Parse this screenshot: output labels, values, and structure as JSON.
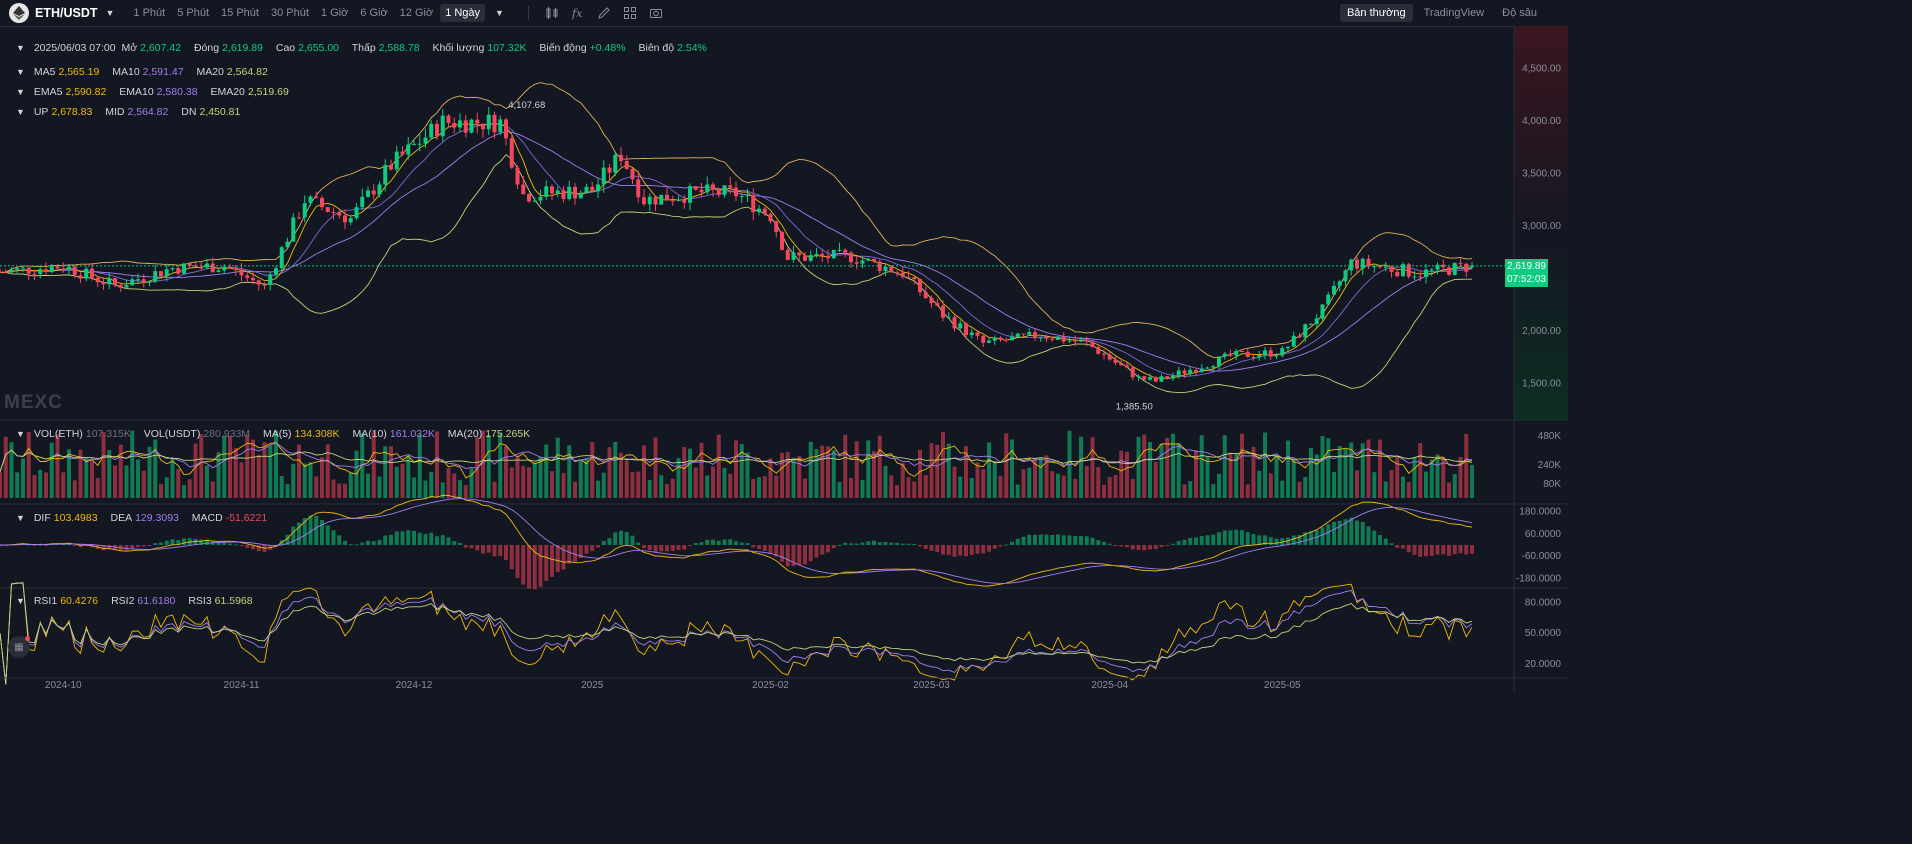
{
  "header": {
    "symbol": "ETH/USDT",
    "timeframes": [
      "1 Phút",
      "5 Phút",
      "15 Phút",
      "30 Phút",
      "1 Giờ",
      "6 Giờ",
      "12 Giờ",
      "1 Ngày"
    ],
    "active_timeframe": "1 Ngày",
    "tools": [
      "candle-type-icon",
      "indicator-icon",
      "draw-icon",
      "layout-icon",
      "camera-icon"
    ],
    "view_tabs": [
      "Bản thường",
      "TradingView",
      "Độ sâu"
    ],
    "active_view": "Bản thường"
  },
  "ohlc": {
    "date": "2025/06/03 07:00",
    "open_label": "Mở",
    "open": "2,607.42",
    "close_label": "Đóng",
    "close": "2,619.89",
    "high_label": "Cao",
    "high": "2,655.00",
    "low_label": "Thấp",
    "low": "2,588.78",
    "volume_label": "Khối lượng",
    "volume": "107.32K",
    "change_label": "Biến động",
    "change": "+0.48%",
    "amplitude_label": "Biên độ",
    "amplitude": "2.54%"
  },
  "ma": {
    "ma5_label": "MA5",
    "ma5": "2,565.19",
    "ma10_label": "MA10",
    "ma10": "2,591.47",
    "ma20_label": "MA20",
    "ma20": "2,564.82"
  },
  "ema": {
    "ema5_label": "EMA5",
    "ema5": "2,590.82",
    "ema10_label": "EMA10",
    "ema10": "2,580.38",
    "ema20_label": "EMA20",
    "ema20": "2,519.69"
  },
  "boll": {
    "up_label": "UP",
    "up": "2,678.83",
    "mid_label": "MID",
    "mid": "2,564.82",
    "dn_label": "DN",
    "dn": "2,450.81"
  },
  "vol": {
    "eth_label": "VOL(ETH)",
    "eth": "107.315K",
    "usdt_label": "VOL(USDT)",
    "usdt": "280.933M",
    "ma5_label": "MA(5)",
    "ma5": "134.308K",
    "ma10_label": "MA(10)",
    "ma10": "161.032K",
    "ma20_label": "MA(20)",
    "ma20": "175.265K"
  },
  "macd": {
    "dif_label": "DIF",
    "dif": "103.4983",
    "dea_label": "DEA",
    "dea": "129.3093",
    "macd_label": "MACD",
    "macd": "-51.6221"
  },
  "rsi": {
    "rsi1_label": "RSI1",
    "rsi1": "60.4276",
    "rsi2_label": "RSI2",
    "rsi2": "61.6180",
    "rsi3_label": "RSI3",
    "rsi3": "61.5968"
  },
  "watermark": "MEXC",
  "price_tag": {
    "price": "2,619.89",
    "countdown": "07:52:03"
  },
  "max_label": "4,107.68",
  "min_label": "1,385.50",
  "colors": {
    "up": "#0ecb81",
    "down": "#f6465d",
    "ma5": "#f0b90b",
    "ma10": "#a27ef0",
    "ma20": "#c3d47a",
    "boll": "#e0b25a"
  },
  "chart_data": {
    "type": "candlestick",
    "series_summary": "ETH/USDT daily candles, Sep 2024 – Jun 2025",
    "price_axis": {
      "ticks": [
        "4,500.00",
        "4,000.00",
        "3,500.00",
        "3,000.00",
        "2,000.00",
        "1,500.00"
      ],
      "ylim": [
        1150,
        4850
      ]
    },
    "x_ticks": [
      "2024-10",
      "2024-11",
      "2024-12",
      "2025",
      "2025-02",
      "2025-03",
      "2025-04",
      "2025-05"
    ],
    "close_points": [
      [
        "2024-09-20",
        2560
      ],
      [
        "2024-10-01",
        2620
      ],
      [
        "2024-10-10",
        2430
      ],
      [
        "2024-10-20",
        2600
      ],
      [
        "2024-10-29",
        2620
      ],
      [
        "2024-11-05",
        2420
      ],
      [
        "2024-11-12",
        3250
      ],
      [
        "2024-11-20",
        3070
      ],
      [
        "2024-11-27",
        3580
      ],
      [
        "2024-12-06",
        3990
      ],
      [
        "2024-12-16",
        3990
      ],
      [
        "2024-12-20",
        3300
      ],
      [
        "2025-01-01",
        3340
      ],
      [
        "2025-01-06",
        3680
      ],
      [
        "2025-01-10",
        3250
      ],
      [
        "2025-01-20",
        3320
      ],
      [
        "2025-01-26",
        3310
      ],
      [
        "2025-02-01",
        3100
      ],
      [
        "2025-02-04",
        2700
      ],
      [
        "2025-02-15",
        2710
      ],
      [
        "2025-02-24",
        2550
      ],
      [
        "2025-03-03",
        2150
      ],
      [
        "2025-03-10",
        1880
      ],
      [
        "2025-03-20",
        1960
      ],
      [
        "2025-03-28",
        1880
      ],
      [
        "2025-04-06",
        1550
      ],
      [
        "2025-04-09",
        1520
      ],
      [
        "2025-04-22",
        1760
      ],
      [
        "2025-05-01",
        1800
      ],
      [
        "2025-05-08",
        2200
      ],
      [
        "2025-05-13",
        2650
      ],
      [
        "2025-05-25",
        2550
      ],
      [
        "2025-06-03",
        2619.89
      ]
    ],
    "volume_axis": {
      "ticks": [
        "480K",
        "240K",
        "80K"
      ]
    },
    "macd_axis": {
      "ticks": [
        "180.0000",
        "60.0000",
        "-60.0000",
        "-180.0000"
      ]
    },
    "rsi_axis": {
      "ticks": [
        "80.0000",
        "50.0000",
        "20.0000"
      ]
    }
  }
}
